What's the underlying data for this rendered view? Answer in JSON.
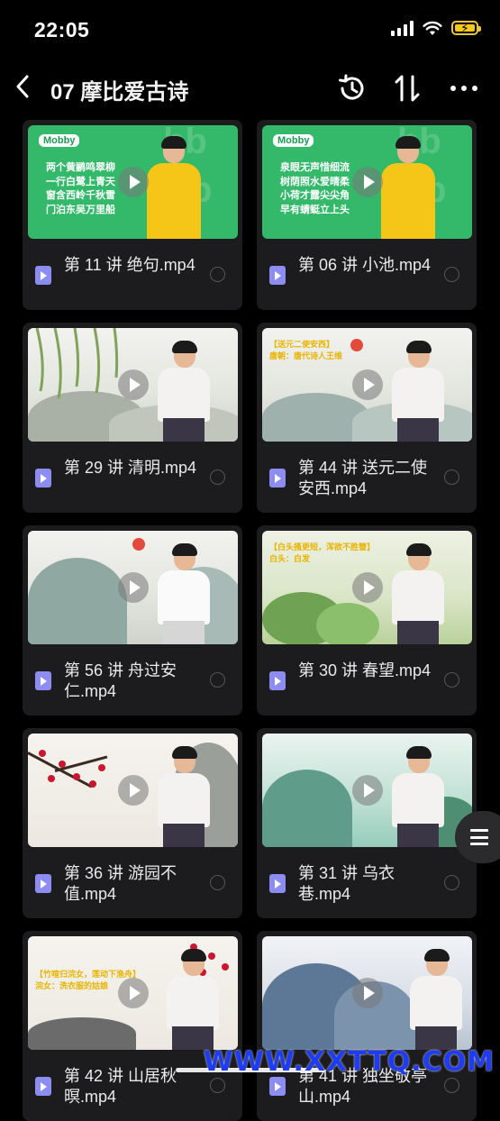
{
  "status_bar": {
    "time": "22:05"
  },
  "nav": {
    "title": "07 摩比爱古诗"
  },
  "videos": [
    {
      "name": "第 11 讲 绝句.mp4",
      "scene": "green",
      "verse": [
        "两个黄鹂鸣翠柳",
        "一行白鹭上青天",
        "窗含西岭千秋雪",
        "门泊东吴万里船"
      ]
    },
    {
      "name": "第 06 讲 小池.mp4",
      "scene": "green",
      "verse": [
        "泉眼无声惜细流",
        "树荫照水爱晴柔",
        "小荷才露尖尖角",
        "早有蜻蜓立上头"
      ]
    },
    {
      "name": "第 29 讲 清明.mp4",
      "scene": "ink"
    },
    {
      "name": "第 44 讲 送元二使安西.mp4",
      "scene": "ink-sun",
      "caption": [
        "【送元二使安西】",
        "唐朝：唐代诗人王维"
      ]
    },
    {
      "name": "第 56 讲 舟过安仁.mp4",
      "scene": "ink-boat"
    },
    {
      "name": "第 30 讲 春望.mp4",
      "scene": "lotus",
      "caption": [
        "【白头搔更短，浑欲不胜簪】",
        "白头：白发"
      ]
    },
    {
      "name": "第 36 讲 游园不值.mp4",
      "scene": "plum"
    },
    {
      "name": "第 31 讲 乌衣巷.mp4",
      "scene": "teal"
    },
    {
      "name": "第 42 讲 山居秋暝.mp4",
      "scene": "plum-red",
      "caption": [
        "【竹喧归浣女，莲动下渔舟】",
        "浣女：洗衣服的姑娘"
      ]
    },
    {
      "name": "第 41 讲 独坐敬亭山.mp4",
      "scene": "blue"
    }
  ],
  "watermark": "WWW.XXTTQ.COM",
  "brand": "Mobby"
}
